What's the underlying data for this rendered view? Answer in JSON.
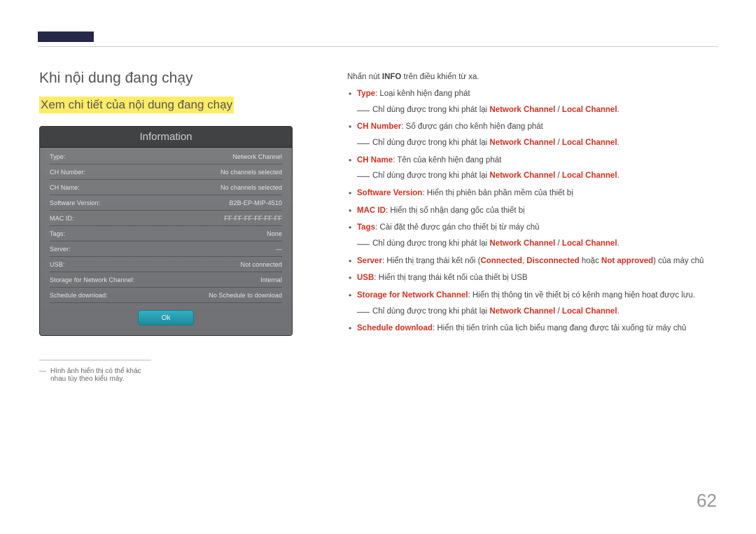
{
  "section_title": "Khi nội dung đang chạy",
  "highlight_title": "Xem chi tiết của nội dung đang chạy",
  "info": {
    "header": "Information",
    "rows": [
      {
        "k": "Type",
        "v": "Network Channel"
      },
      {
        "k": "CH Number",
        "v": "No channels selected"
      },
      {
        "k": "CH Name",
        "v": "No channels selected"
      },
      {
        "k": "Software Version",
        "v": "B2B-EP-MIP-4510"
      },
      {
        "k": "MAC ID",
        "v": "FF-FF-FF-FF-FF-FF"
      },
      {
        "k": "Tags",
        "v": "None"
      },
      {
        "k": "Server",
        "v": "—"
      },
      {
        "k": "USB",
        "v": "Not connected"
      },
      {
        "k": "Storage for Network Channel",
        "v": "Internal"
      },
      {
        "k": "Schedule download",
        "v": "No Schedule to download"
      }
    ],
    "ok": "Ok"
  },
  "footnote_text": "Hình ảnh hiển thị có thể khác nhau tùy theo kiểu máy.",
  "intro_pre": "Nhấn nút ",
  "intro_bold": "INFO",
  "intro_post": " trên điều khiển từ xa.",
  "items": {
    "type_key": "Type",
    "type_text": ": Loại kênh hiện đang phát",
    "only_when_pre": "Chỉ dùng được trong khi phát lại ",
    "nc": "Network Channel",
    "slash": " / ",
    "lc": "Local Channel",
    "period": ".",
    "chnum_key": "CH Number",
    "chnum_text": ": Số được gán cho kênh hiện đang phát",
    "chname_key": "CH Name",
    "chname_text": ": Tên của kênh hiện đang phát",
    "sw_key": "Software Version",
    "sw_text": ": Hiển thị phiên bản phần mềm của thiết bị",
    "mac_key": "MAC ID",
    "mac_text": ": Hiển thị số nhận dạng gốc của thiết bị",
    "tags_key": "Tags",
    "tags_text": ": Cài đặt thẻ được gán cho thiết bị từ máy chủ",
    "server_key": "Server",
    "server_text_pre": ": Hiển thị trạng thái kết nối (",
    "connected": "Connected",
    "comma": ", ",
    "disconnected": "Disconnected",
    "server_or": " hoặc ",
    "not_approved": "Not approved",
    "server_text_post": ") của máy chủ",
    "usb_key": "USB",
    "usb_text": ": Hiển thị trạng thái kết nối của thiết bị USB",
    "storage_key": "Storage for Network Channel",
    "storage_text": ": Hiển thị thông tin về thiết bị có kênh mạng hiện hoạt được lưu.",
    "sched_key": "Schedule download",
    "sched_text": ": Hiển thị tiến trình của lịch biểu mạng đang được tải xuống từ máy chủ"
  },
  "page_num": "62"
}
